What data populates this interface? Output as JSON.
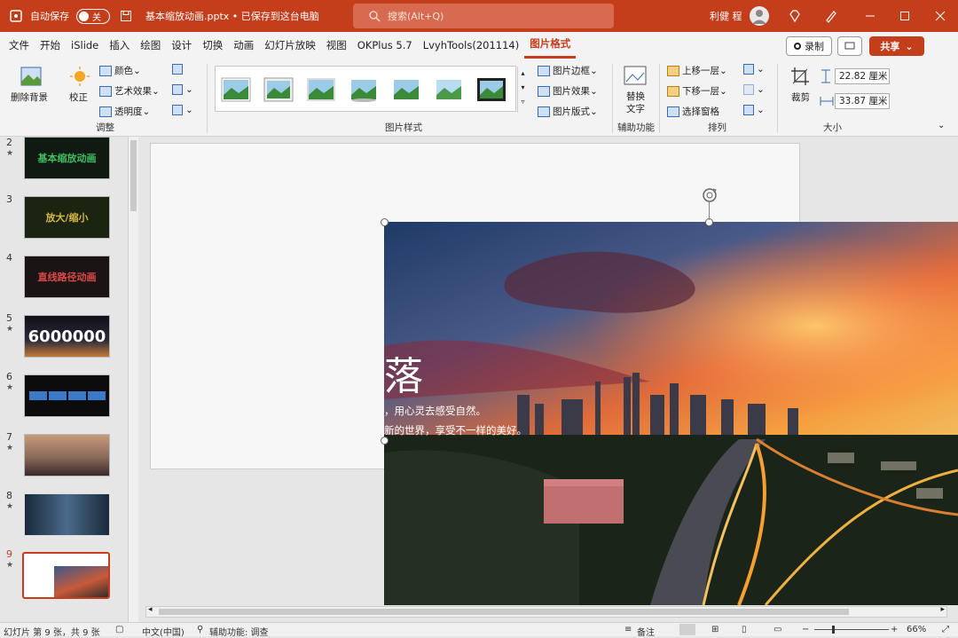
{
  "app": {
    "autosave_label": "自动保存",
    "autosave_state": "关",
    "doc_title": "基本缩放动画.pptx • 已保存到这台电脑",
    "search_placeholder": "搜索(Alt+Q)",
    "user_name": "利健 程"
  },
  "ribbon_tabs": [
    "文件",
    "开始",
    "iSlide",
    "插入",
    "绘图",
    "设计",
    "切换",
    "动画",
    "幻灯片放映",
    "视图",
    "OKPlus 5.7",
    "LvyhTools(201114)",
    "图片格式"
  ],
  "active_tab": "图片格式",
  "header_buttons": {
    "record": "录制",
    "share": "共享"
  },
  "ribbon": {
    "adjust": {
      "remove_bg": "删除背景",
      "correct": "校正",
      "color": "颜色",
      "art_effect": "艺术效果",
      "transparency": "透明度",
      "label": "调整"
    },
    "styles": {
      "border": "图片边框",
      "effect": "图片效果",
      "layout": "图片版式",
      "label": "图片样式"
    },
    "access": {
      "alt_text_1": "替换",
      "alt_text_2": "文字",
      "label": "辅助功能"
    },
    "arrange": {
      "bring_forward": "上移一层",
      "send_backward": "下移一层",
      "selection_pane": "选择窗格",
      "label": "排列"
    },
    "size": {
      "crop": "裁剪",
      "height": "22.82 厘米",
      "width": "33.87 厘米",
      "label": "大小"
    }
  },
  "slides": [
    {
      "num": "2",
      "star": "★",
      "text": "基本缩放动画",
      "color": "#3fbf5f"
    },
    {
      "num": "3",
      "star": "",
      "text": "放大/缩小",
      "color": "#d8b84a"
    },
    {
      "num": "4",
      "star": "",
      "text": "直线路径动画",
      "color": "#e04848"
    },
    {
      "num": "5",
      "star": "★",
      "text": "6000000",
      "color": "#ffffff"
    },
    {
      "num": "6",
      "star": "★",
      "text": "",
      "color": "#ffffff"
    },
    {
      "num": "7",
      "star": "★",
      "text": "",
      "color": "#ffffff"
    },
    {
      "num": "8",
      "star": "★",
      "text": "",
      "color": "#ffffff"
    },
    {
      "num": "9",
      "star": "★",
      "text": "",
      "color": "#ffffff"
    }
  ],
  "photo_text": {
    "headline": "落",
    "line1": "，用心灵去感受自然。",
    "line2": "新的世界，享受不一样的美好。"
  },
  "status": {
    "slide_info": "幻灯片 第 9 张，共 9 张",
    "language": "中文(中国)",
    "accessibility": "辅助功能: 调查",
    "notes": "备注",
    "zoom": "66%"
  },
  "colors": {
    "accent": "#c43e1c"
  }
}
